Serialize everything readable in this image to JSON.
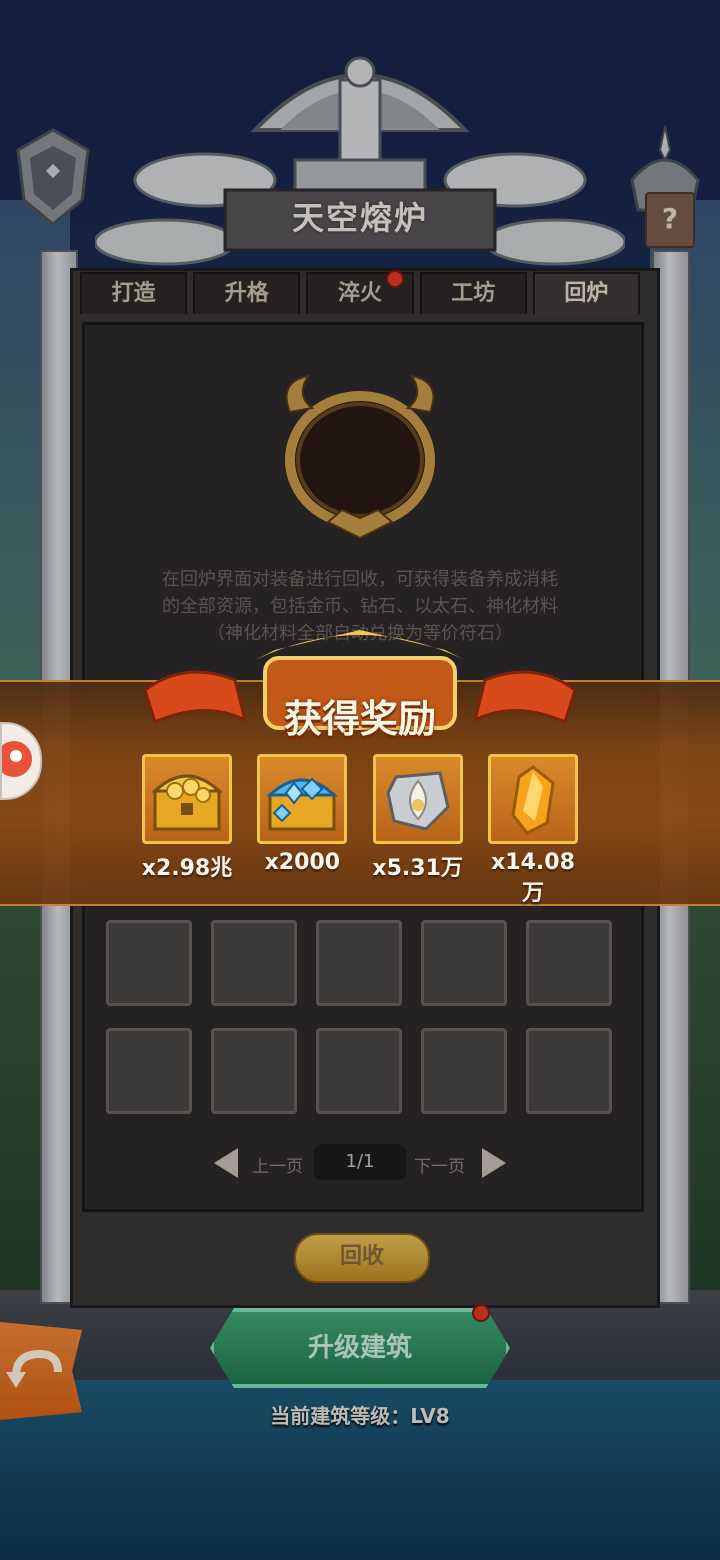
{
  "screen": {
    "title": "天空熔炉",
    "help_symbol": "?"
  },
  "tabs": [
    {
      "label": "打造",
      "active": false,
      "badge": false
    },
    {
      "label": "升格",
      "active": false,
      "badge": false
    },
    {
      "label": "淬火",
      "active": false,
      "badge": true
    },
    {
      "label": "工坊",
      "active": false,
      "badge": false
    },
    {
      "label": "回炉",
      "active": true,
      "badge": false
    }
  ],
  "recycle": {
    "description_lines": [
      "在回炉界面对装备进行回收，可获得装备养成消耗",
      "的全部资源，包括金币、钻石、以太石、神化材料",
      "（神化材料全部自动兑换为等价符石）"
    ],
    "pager": {
      "prev_label": "上一页",
      "page": "1/1",
      "next_label": "下一页"
    },
    "recycle_button": "回收"
  },
  "footer": {
    "upgrade_button": "升级建筑",
    "level_text": "当前建筑等级：LV8"
  },
  "reward_popup": {
    "title": "获得奖励",
    "items": [
      {
        "icon": "gold-chest-icon",
        "qty": "x2.98兆"
      },
      {
        "icon": "diamond-chest-icon",
        "qty": "x2000"
      },
      {
        "icon": "ether-stone-icon",
        "qty": "x5.31万"
      },
      {
        "icon": "rune-crystal-icon",
        "qty": "x14.08万"
      }
    ]
  },
  "colors": {
    "panel": "#3a3636",
    "accent_gold": "#f1c44a",
    "upgrade_green": "#43a878",
    "badge_red": "#e23a2a",
    "reward_band": "#8a4a16"
  }
}
